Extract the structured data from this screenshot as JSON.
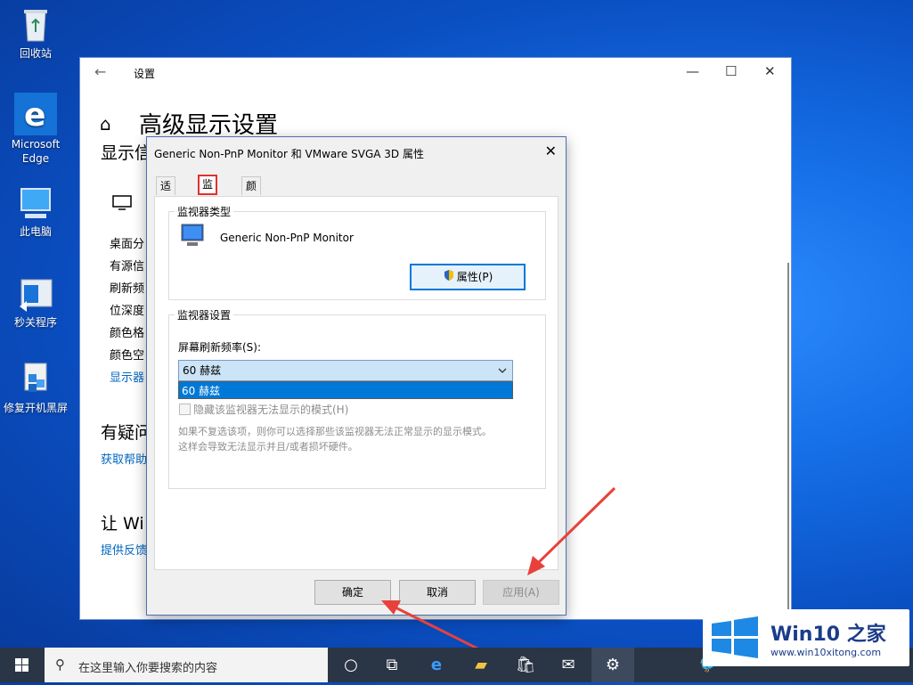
{
  "desktop": {
    "icons": [
      {
        "label": "回收站"
      },
      {
        "label": "Microsoft Edge"
      },
      {
        "label": "此电脑"
      },
      {
        "label": "秒关程序"
      },
      {
        "label": "修复开机黑屏"
      }
    ]
  },
  "settings": {
    "title": "设置",
    "page_title": "高级显示设置",
    "section_display": "显示信",
    "items": [
      "桌面分",
      "有源信",
      "刷新频",
      "位深度",
      "颜色格",
      "颜色空"
    ],
    "adapter_link": "显示器",
    "section_help": "有疑问",
    "help_link": "获取帮助",
    "section_feedback": "让 Wi",
    "feedback_link": "提供反馈"
  },
  "dialog": {
    "title": "Generic Non-PnP Monitor 和 VMware SVGA 3D 属性",
    "tabs": [
      "适配器",
      "监视器",
      "颜色管理"
    ],
    "monitor_type_label": "监视器类型",
    "monitor_name": "Generic Non-PnP Monitor",
    "properties_button": "属性(P)",
    "monitor_settings_label": "监视器设置",
    "refresh_rate_label": "屏幕刷新频率(S):",
    "refresh_rate_value": "60 赫兹",
    "refresh_rate_option": "60 赫兹",
    "hide_modes_label": "隐藏该监视器无法显示的模式(H)",
    "note_line1": "如果不复选该项，则你可以选择那些该监视器无法正常显示的显示模式。",
    "note_line2": "这样会导致无法显示并且/或者损坏硬件。",
    "ok_button": "确定",
    "cancel_button": "取消",
    "apply_button": "应用(A)"
  },
  "taskbar": {
    "search_placeholder": "在这里输入你要搜索的内容"
  },
  "watermark": {
    "brand": "Win10 之家",
    "url": "www.win10xitong.com"
  },
  "colors": {
    "accent": "#0078d7",
    "link": "#0067c0",
    "highlight_border": "#e03030",
    "arrow": "#e8413b"
  }
}
